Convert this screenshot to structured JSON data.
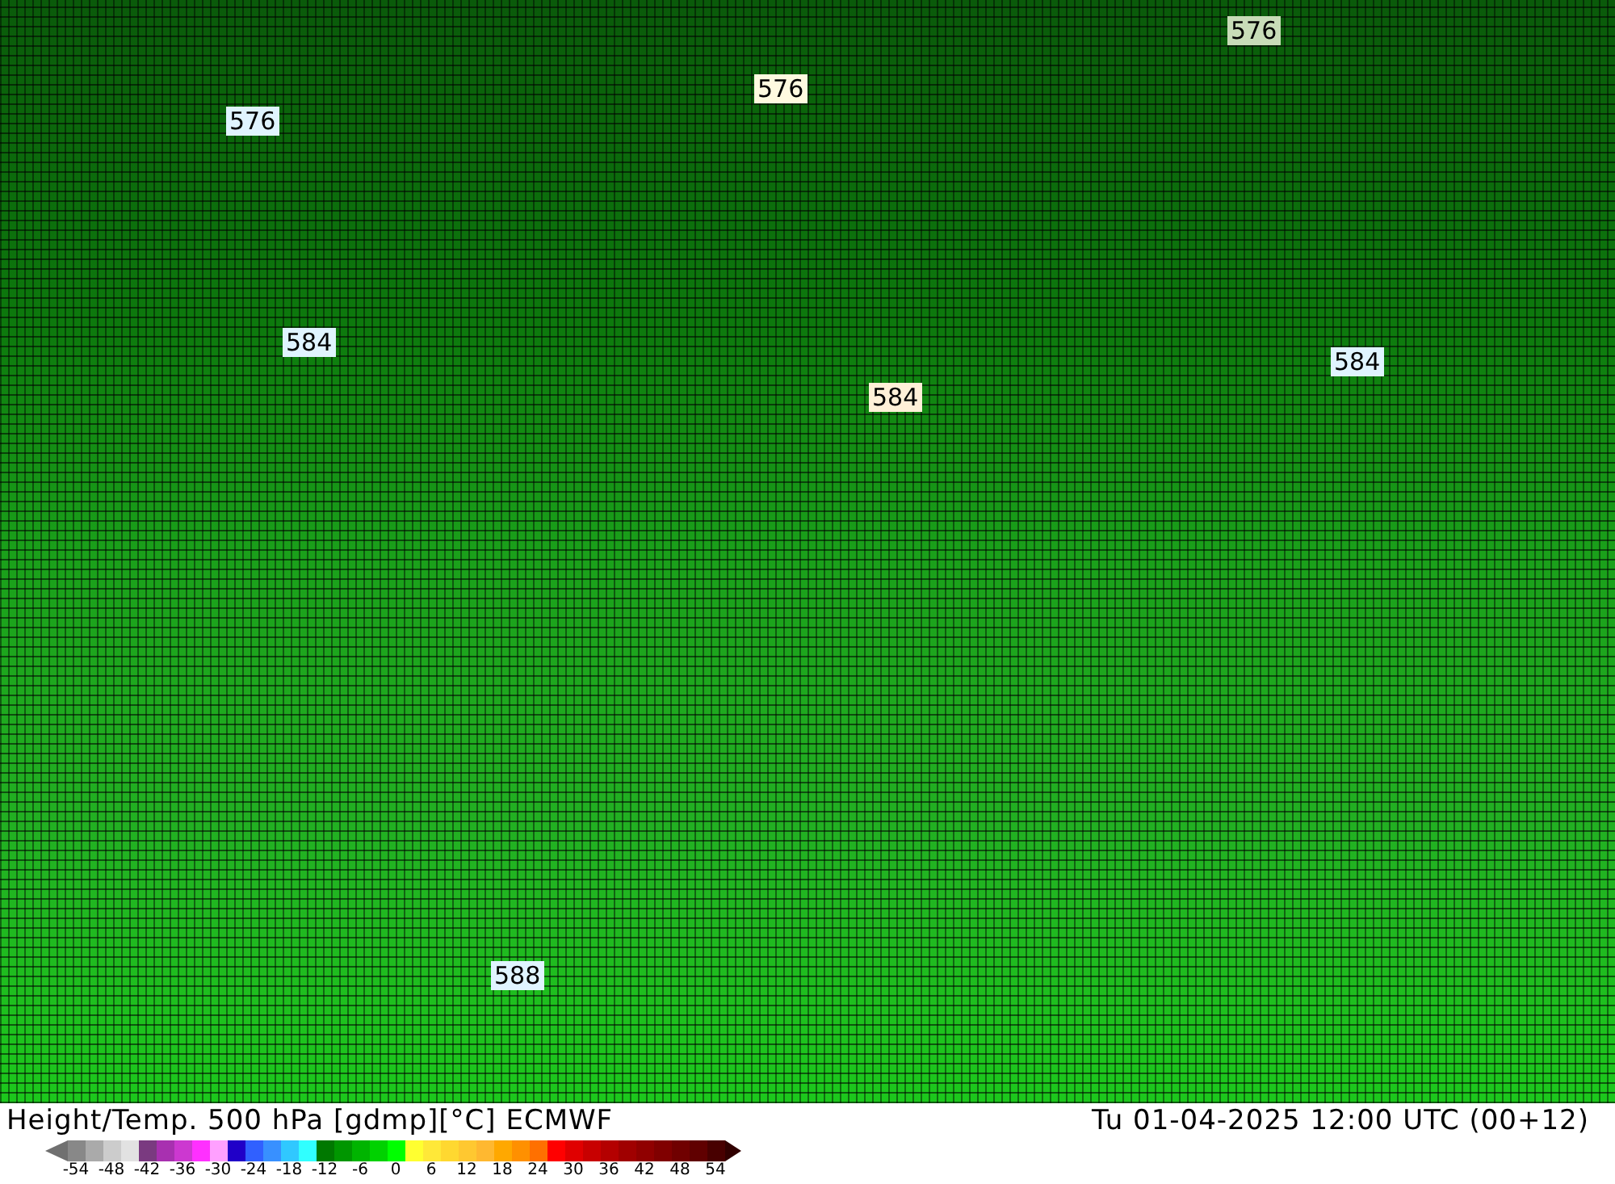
{
  "map": {
    "contour_labels": [
      {
        "text": "576",
        "color": "#c8dcb8"
      },
      {
        "text": "576",
        "color": "#fffae0"
      },
      {
        "text": "576",
        "color": "#e0f4ff"
      },
      {
        "text": "584",
        "color": "#e0f4ff"
      },
      {
        "text": "584",
        "color": "#fff0d8"
      },
      {
        "text": "584",
        "color": "#e0f4ff"
      },
      {
        "text": "588",
        "color": "#e0f4ff"
      }
    ]
  },
  "footer": {
    "title": "Height/Temp. 500 hPa [gdmp][°C] ECMWF",
    "valid_time": "Tu 01-04-2025 12:00 UTC (00+12)"
  },
  "legend": {
    "end_arrows": [
      {
        "color": "#707070"
      },
      {
        "color": "#300000"
      }
    ],
    "swatches": [
      {
        "color": "#888888"
      },
      {
        "color": "#aaaaaa"
      },
      {
        "color": "#cccccc"
      },
      {
        "color": "#e2e2e2"
      },
      {
        "color": "#7a3a80"
      },
      {
        "color": "#a830b0"
      },
      {
        "color": "#cc38d0"
      },
      {
        "color": "#ff30ff"
      },
      {
        "color": "#ffa0ff"
      },
      {
        "color": "#2000c8"
      },
      {
        "color": "#3060ff"
      },
      {
        "color": "#3890ff"
      },
      {
        "color": "#30c8ff"
      },
      {
        "color": "#30ffff"
      },
      {
        "color": "#007800"
      },
      {
        "color": "#009600"
      },
      {
        "color": "#00b400"
      },
      {
        "color": "#00d200"
      },
      {
        "color": "#00ff00"
      },
      {
        "color": "#ffff30"
      },
      {
        "color": "#ffe838"
      },
      {
        "color": "#ffd830"
      },
      {
        "color": "#ffc830"
      },
      {
        "color": "#ffb830"
      },
      {
        "color": "#ffa800"
      },
      {
        "color": "#ff9000"
      },
      {
        "color": "#ff7000"
      },
      {
        "color": "#ff0000"
      },
      {
        "color": "#e00000"
      },
      {
        "color": "#c80000"
      },
      {
        "color": "#b40000"
      },
      {
        "color": "#a00000"
      },
      {
        "color": "#900000"
      },
      {
        "color": "#800000"
      },
      {
        "color": "#700000"
      },
      {
        "color": "#600000"
      },
      {
        "color": "#480000"
      }
    ],
    "ticks": [
      "-54",
      "-48",
      "-42",
      "-36",
      "-30",
      "-24",
      "-18",
      "-12",
      "-6",
      "0",
      "6",
      "12",
      "18",
      "24",
      "30",
      "36",
      "42",
      "48",
      "54"
    ]
  }
}
